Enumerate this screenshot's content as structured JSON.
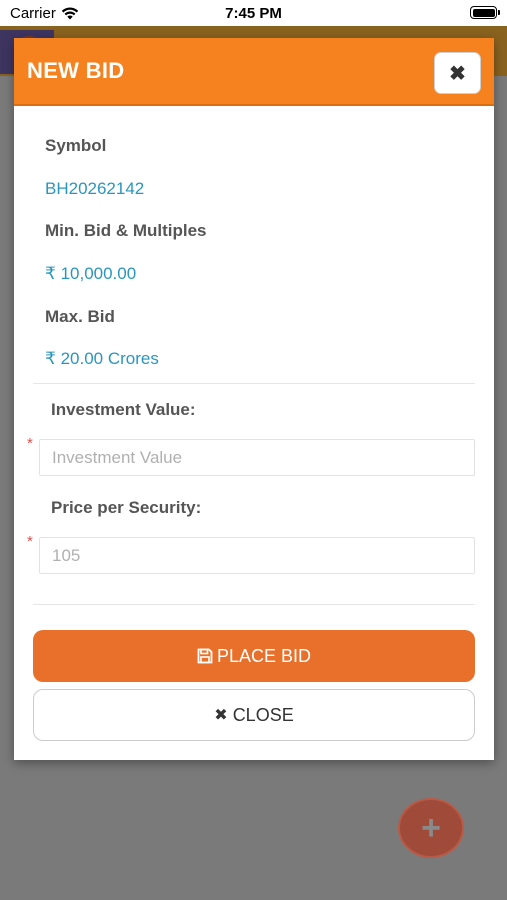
{
  "status_bar": {
    "carrier": "Carrier",
    "time": "7:45 PM"
  },
  "modal": {
    "title": "NEW BID",
    "close_icon_glyph": "✖",
    "symbol_label": "Symbol",
    "symbol_value": "BH20262142",
    "min_bid_label": "Min. Bid & Multiples",
    "min_bid_value": "10,000.00",
    "max_bid_label": "Max. Bid",
    "max_bid_value": "20.00 Crores",
    "currency_symbol": "₹",
    "investment_label": "Investment Value:",
    "investment_placeholder": "Investment Value",
    "investment_value": "",
    "price_label": "Price per Security:",
    "price_placeholder": "105",
    "required_marker": "*",
    "place_bid_label": "PLACE BID",
    "close_label": "CLOSE"
  },
  "fab": {
    "glyph": "+"
  },
  "colors": {
    "accent_orange": "#f5821f",
    "button_orange": "#e8702a",
    "value_blue": "#2a96bd"
  }
}
